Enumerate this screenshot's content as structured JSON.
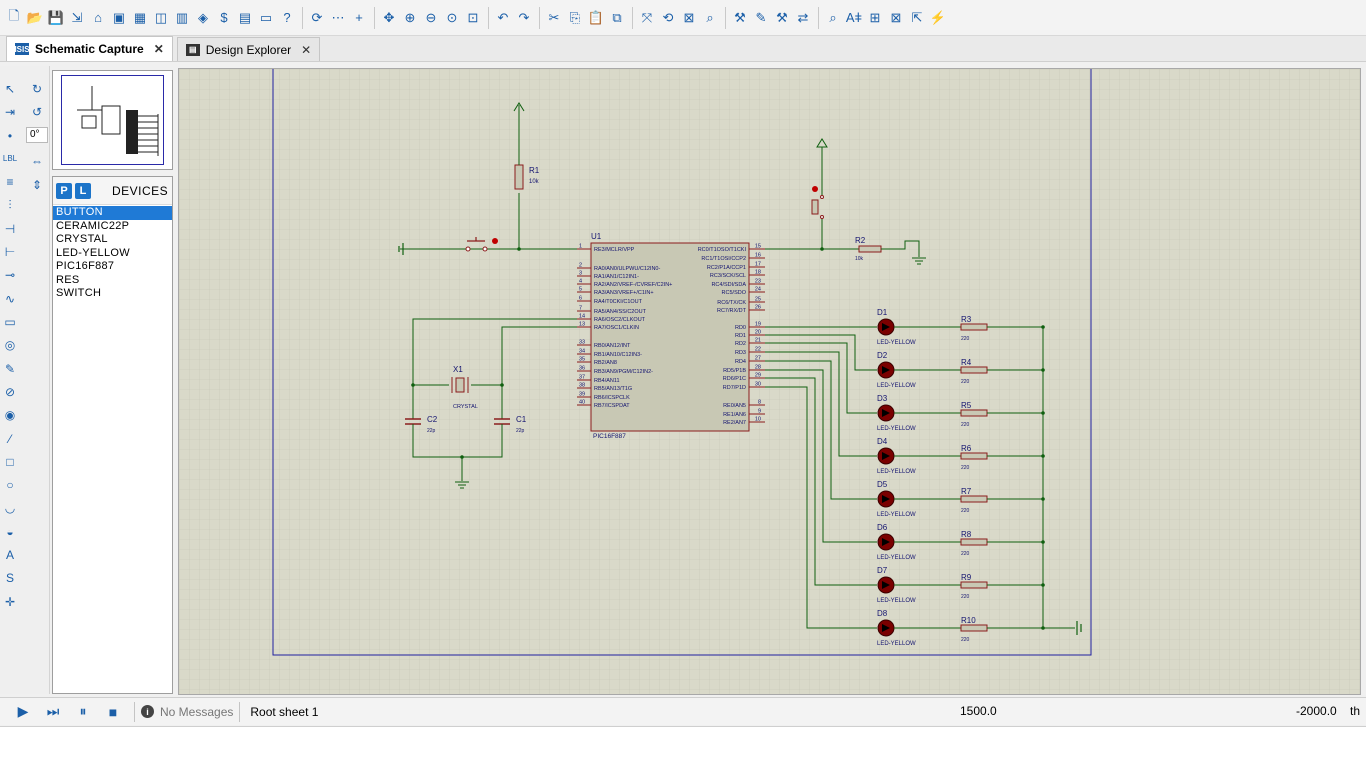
{
  "toolbar": {
    "icons": [
      "new-file-icon",
      "open-folder-icon",
      "save-icon",
      "import-icon",
      "home-icon",
      "schematic-icon",
      "pcb-icon",
      "gerber-icon",
      "library-icon",
      "component-icon",
      "bom-icon",
      "source-code-icon",
      "design-report-icon",
      "help-icon",
      "refresh-icon",
      "grid-icon",
      "origin-icon",
      "pan-icon",
      "zoom-in-icon",
      "zoom-out-icon",
      "zoom-all-icon",
      "zoom-area-icon",
      "undo-icon",
      "redo-icon",
      "cut-icon",
      "copy-icon",
      "paste-icon",
      "block-copy-icon",
      "block-move-icon",
      "block-rotate-icon",
      "block-delete-icon",
      "pick-device-icon",
      "make-device-icon",
      "packaging-icon",
      "decompose-icon",
      "wire-autorouter-icon",
      "search-icon",
      "property-assignment-icon",
      "new-sheet-icon",
      "remove-sheet-icon",
      "exit-parent-icon",
      "electrical-rule-check-icon"
    ]
  },
  "tabs": [
    {
      "label": "Schematic Capture",
      "icon": "schematic-tab-icon",
      "active": true
    },
    {
      "label": "Design Explorer",
      "icon": "design-explorer-tab-icon",
      "active": false
    }
  ],
  "tools": {
    "rotation_value": "0°",
    "icons": [
      "selection-icon",
      "component-icon",
      "junction-icon",
      "wire-label-icon",
      "text-script-icon",
      "buses-icon",
      "subcircuit-icon",
      "terminals-icon",
      "device-pins-icon",
      "graph-icon",
      "tape-recorder-icon",
      "generators-icon",
      "voltage-probe-icon",
      "current-probe-icon",
      "virtual-instruments-icon",
      "line-icon",
      "box-icon",
      "circle-icon",
      "arc-icon",
      "path-icon",
      "text-icon",
      "symbol-icon",
      "marker-icon"
    ]
  },
  "devices": {
    "p_label": "P",
    "l_label": "L",
    "title": "DEVICES",
    "items": [
      "BUTTON",
      "CERAMIC22P",
      "CRYSTAL",
      "LED-YELLOW",
      "PIC16F887",
      "RES",
      "SWITCH"
    ],
    "selected_index": 0
  },
  "schematic": {
    "mcu": {
      "ref": "U1",
      "part": "PIC16F887",
      "left_pins": [
        {
          "num": "1",
          "name": "RE3/MCLR/VPP"
        },
        {
          "num": "2",
          "name": "RA0/AN0/ULPWU/C12IN0-"
        },
        {
          "num": "3",
          "name": "RA1/AN1/C12IN1-"
        },
        {
          "num": "4",
          "name": "RA2/AN2/VREF-/CVREF/C2IN+"
        },
        {
          "num": "5",
          "name": "RA3/AN3/VREF+/C1IN+"
        },
        {
          "num": "6",
          "name": "RA4/T0CKI/C1OUT"
        },
        {
          "num": "7",
          "name": "RA5/AN4/SS/C2OUT"
        },
        {
          "num": "14",
          "name": "RA6/OSC2/CLKOUT"
        },
        {
          "num": "13",
          "name": "RA7/OSC1/CLKIN"
        },
        {
          "num": "33",
          "name": "RB0/AN12/INT"
        },
        {
          "num": "34",
          "name": "RB1/AN10/C12IN3-"
        },
        {
          "num": "35",
          "name": "RB2/AN8"
        },
        {
          "num": "36",
          "name": "RB3/AN9/PGM/C12IN2-"
        },
        {
          "num": "37",
          "name": "RB4/AN11"
        },
        {
          "num": "38",
          "name": "RB5/AN13/T1G"
        },
        {
          "num": "39",
          "name": "RB6/ICSPCLK"
        },
        {
          "num": "40",
          "name": "RB7/ICSPDAT"
        }
      ],
      "right_pins": [
        {
          "num": "15",
          "name": "RC0/T1OSO/T1CKI"
        },
        {
          "num": "16",
          "name": "RC1/T1OSI/CCP2"
        },
        {
          "num": "17",
          "name": "RC2/P1A/CCP1"
        },
        {
          "num": "18",
          "name": "RC3/SCK/SCL"
        },
        {
          "num": "23",
          "name": "RC4/SDI/SDA"
        },
        {
          "num": "24",
          "name": "RC5/SDO"
        },
        {
          "num": "25",
          "name": "RC6/TX/CK"
        },
        {
          "num": "26",
          "name": "RC7/RX/DT"
        },
        {
          "num": "19",
          "name": "RD0"
        },
        {
          "num": "20",
          "name": "RD1"
        },
        {
          "num": "21",
          "name": "RD2"
        },
        {
          "num": "22",
          "name": "RD3"
        },
        {
          "num": "27",
          "name": "RD4"
        },
        {
          "num": "28",
          "name": "RD5/P1B"
        },
        {
          "num": "29",
          "name": "RD6/P1C"
        },
        {
          "num": "30",
          "name": "RD7/P1D"
        },
        {
          "num": "8",
          "name": "RE0/AN5"
        },
        {
          "num": "9",
          "name": "RE1/AN6"
        },
        {
          "num": "10",
          "name": "RE2/AN7"
        }
      ]
    },
    "r1": {
      "ref": "R1",
      "value": "10k"
    },
    "r2": {
      "ref": "R2",
      "value": "10k"
    },
    "x1": {
      "ref": "X1",
      "part": "CRYSTAL"
    },
    "c1": {
      "ref": "C1",
      "value": "22p"
    },
    "c2": {
      "ref": "C2",
      "value": "22p"
    },
    "leds": [
      {
        "ref": "D1",
        "part": "LED-YELLOW",
        "res": "R3",
        "rval": "220"
      },
      {
        "ref": "D2",
        "part": "LED-YELLOW",
        "res": "R4",
        "rval": "220"
      },
      {
        "ref": "D3",
        "part": "LED-YELLOW",
        "res": "R5",
        "rval": "220"
      },
      {
        "ref": "D4",
        "part": "LED-YELLOW",
        "res": "R6",
        "rval": "220"
      },
      {
        "ref": "D5",
        "part": "LED-YELLOW",
        "res": "R7",
        "rval": "220"
      },
      {
        "ref": "D6",
        "part": "LED-YELLOW",
        "res": "R8",
        "rval": "220"
      },
      {
        "ref": "D7",
        "part": "LED-YELLOW",
        "res": "R9",
        "rval": "220"
      },
      {
        "ref": "D8",
        "part": "LED-YELLOW",
        "res": "R10",
        "rval": "220"
      }
    ],
    "colors": {
      "grid_bg": "#d9d9c9",
      "grid_line": "#c5c5b6",
      "wire": "#0f5f0f",
      "part_body": "#c8c8b4",
      "part_outline": "#8a1c1c",
      "text": "#141470",
      "sheet_border": "#2020a0",
      "led": "#7a0000"
    }
  },
  "status": {
    "message": "No Messages",
    "sheet": "Root sheet 1",
    "x": "1500.0",
    "y": "-2000.0",
    "unit": "th"
  }
}
